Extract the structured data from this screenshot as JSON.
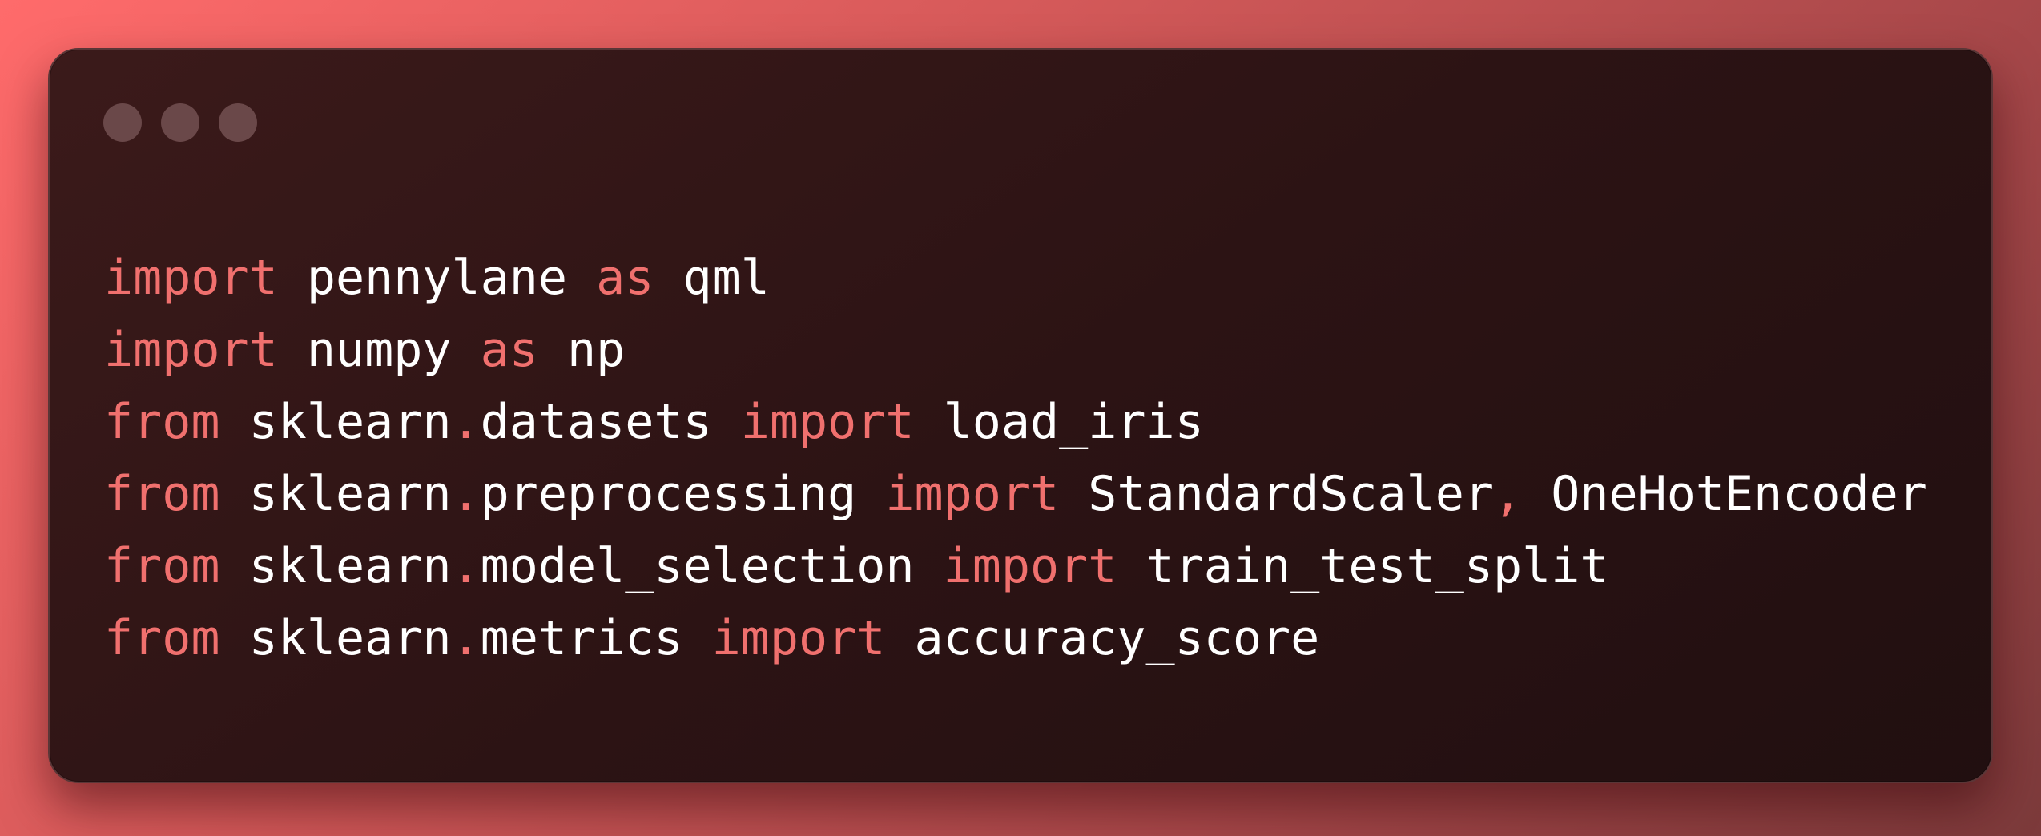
{
  "window": {
    "controls": [
      "window-dot-1",
      "window-dot-2",
      "window-dot-3"
    ]
  },
  "colors": {
    "keyword": "#f0706e",
    "identifier": "#ffffff",
    "window_bg": "#2c1314",
    "background_start": "#ff6b6b",
    "background_end": "#7c3a3b"
  },
  "code": {
    "lines": [
      {
        "t1": "import",
        "t2": " ",
        "t3": "pennylane",
        "t4": " ",
        "t5": "as",
        "t6": " ",
        "t7": "qml"
      },
      {
        "t1": "import",
        "t2": " ",
        "t3": "numpy",
        "t4": " ",
        "t5": "as",
        "t6": " ",
        "t7": "np"
      },
      {
        "t1": "from",
        "t2": " ",
        "t3": "sklearn",
        "t4": ".",
        "t5": "datasets",
        "t6": " ",
        "t7": "import",
        "t8": " ",
        "t9": "load_iris"
      },
      {
        "t1": "from",
        "t2": " ",
        "t3": "sklearn",
        "t4": ".",
        "t5": "preprocessing",
        "t6": " ",
        "t7": "import",
        "t8": " ",
        "t9": "StandardScaler",
        "t10": ",",
        "t11": " ",
        "t12": "OneHotEncoder"
      },
      {
        "t1": "from",
        "t2": " ",
        "t3": "sklearn",
        "t4": ".",
        "t5": "model_selection",
        "t6": " ",
        "t7": "import",
        "t8": " ",
        "t9": "train_test_split"
      },
      {
        "t1": "from",
        "t2": " ",
        "t3": "sklearn",
        "t4": ".",
        "t5": "metrics",
        "t6": " ",
        "t7": "import",
        "t8": " ",
        "t9": "accuracy_score"
      }
    ]
  }
}
